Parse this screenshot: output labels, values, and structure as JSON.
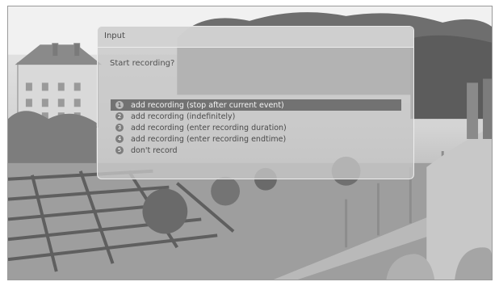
{
  "dialog": {
    "title": "Input",
    "prompt": "Start recording?",
    "options": [
      {
        "number": "1",
        "label": "add recording (stop after current event)",
        "selected": true
      },
      {
        "number": "2",
        "label": "add recording (indefinitely)",
        "selected": false
      },
      {
        "number": "3",
        "label": "add recording (enter recording duration)",
        "selected": false
      },
      {
        "number": "4",
        "label": "add recording (enter recording endtime)",
        "selected": false
      },
      {
        "number": "5",
        "label": "don't record",
        "selected": false
      }
    ]
  },
  "colors": {
    "selection_bar": "#727272",
    "dialog_background": "#c6c6c6"
  }
}
